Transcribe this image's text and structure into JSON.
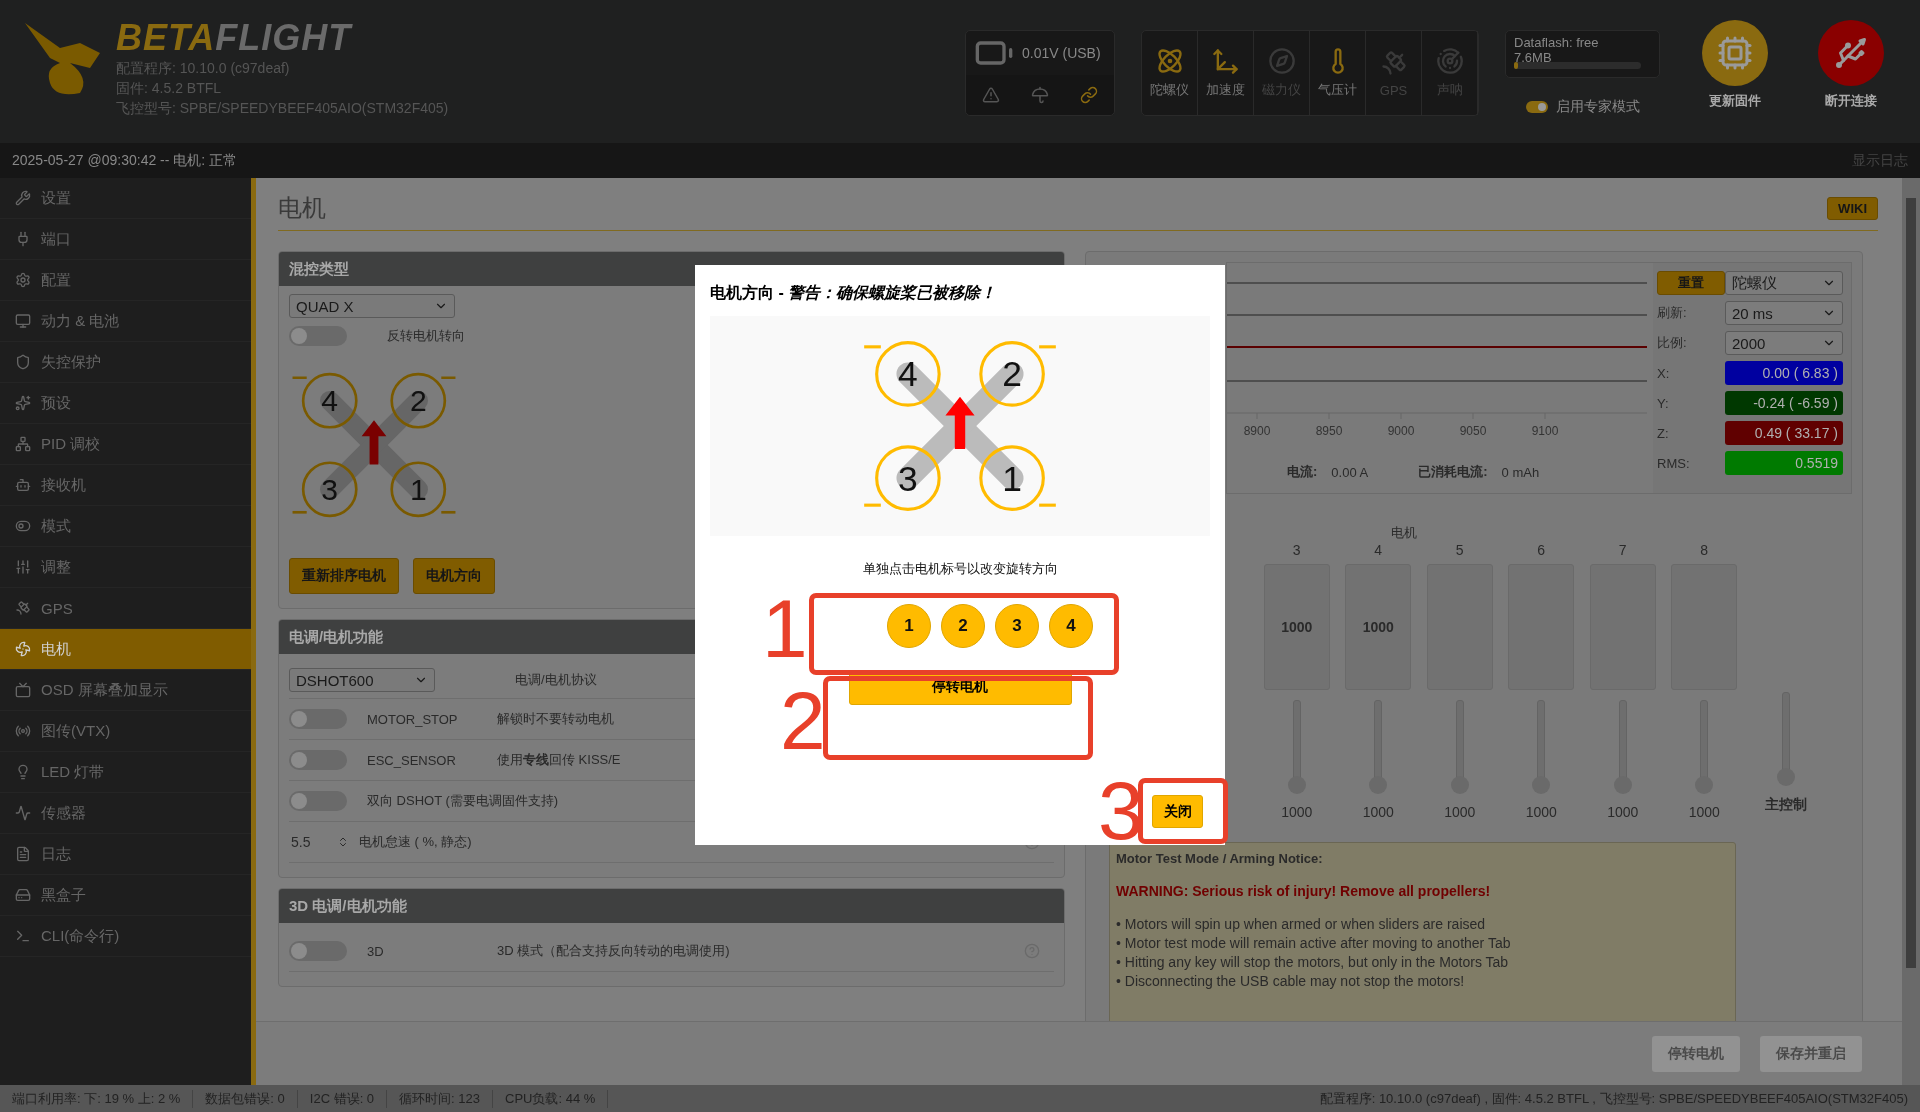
{
  "header": {
    "brand_a": "BETA",
    "brand_b": "FLIGHT",
    "info": [
      "配置程序: 10.10.0 (c97deaf)",
      "固件: 4.5.2 BTFL",
      "飞控型号: SPBE/SPEEDYBEEF405AIO(STM32F405)"
    ],
    "battery": {
      "reading": "0.01V (USB)"
    },
    "sensors": [
      {
        "kind": "gyro",
        "label": "陀螺仪",
        "active": true
      },
      {
        "kind": "accel",
        "label": "加速度",
        "active": true
      },
      {
        "kind": "mag",
        "label": "磁力仪",
        "active": false
      },
      {
        "kind": "baro",
        "label": "气压计",
        "active": true
      },
      {
        "kind": "gps",
        "label": "GPS",
        "active": false
      },
      {
        "kind": "sonar",
        "label": "声呐",
        "active": false
      }
    ],
    "dataflash": {
      "label": "Dataflash: free",
      "size": "7.6MB",
      "level": 0.03
    },
    "expert_mode": {
      "label": "启用专家模式",
      "on": true
    },
    "actions": [
      {
        "kind": "update",
        "label": "更新固件"
      },
      {
        "kind": "disconnect",
        "label": "断开连接"
      }
    ]
  },
  "log_bar": {
    "message": "2025-05-27 @09:30:42 -- 电机: 正常",
    "toggle": "显示日志"
  },
  "sidebar": {
    "items": [
      {
        "label": "设置",
        "selected": false
      },
      {
        "label": "端口",
        "selected": false
      },
      {
        "label": "配置",
        "selected": false
      },
      {
        "label": "动力 & 电池",
        "selected": false
      },
      {
        "label": "失控保护",
        "selected": false
      },
      {
        "label": "预设",
        "selected": false
      },
      {
        "label": "PID 调校",
        "selected": false
      },
      {
        "label": "接收机",
        "selected": false
      },
      {
        "label": "模式",
        "selected": false
      },
      {
        "label": "调整",
        "selected": false
      },
      {
        "label": "GPS",
        "selected": false
      },
      {
        "label": "电机",
        "selected": true
      },
      {
        "label": "OSD 屏幕叠加显示",
        "selected": false
      },
      {
        "label": "图传(VTX)",
        "selected": false
      },
      {
        "label": "LED 灯带",
        "selected": false
      },
      {
        "label": "传感器",
        "selected": false
      },
      {
        "label": "日志",
        "selected": false
      },
      {
        "label": "黑盒子",
        "selected": false
      },
      {
        "label": "CLI(命令行)",
        "selected": false
      }
    ]
  },
  "page": {
    "title": "电机",
    "wiki": "WIKI"
  },
  "mixer": {
    "title": "混控类型",
    "type": "QUAD X",
    "reverse": {
      "label": "反转电机转向",
      "on": false
    },
    "diagram": [
      "4",
      "2",
      "3",
      "1"
    ],
    "buttons": [
      "重新排序电机",
      "电机方向"
    ]
  },
  "esc": {
    "title": "电调/电机功能",
    "protocol": "DSHOT600",
    "protocol_label": "电调/电机协议",
    "features": [
      {
        "kind": "toggle",
        "name": "MOTOR_STOP",
        "description": "解锁时不要转动电机",
        "on": false
      },
      {
        "kind": "toggle",
        "name": "ESC_SENSOR",
        "description": "使用**专线**回传 KISS/E",
        "on": false
      },
      {
        "kind": "toggle",
        "description": "双向 DSHOT (需要电调固件支持)",
        "on": false
      },
      {
        "kind": "number",
        "value": "5.5",
        "description": "电机怠速 ( %, 静态)",
        "help": true
      }
    ]
  },
  "esc3d": {
    "title": "3D 电调/电机功能",
    "features": [
      {
        "kind": "toggle",
        "name": "3D",
        "description": "3D 模式（配合支持反向转动的电调使用)",
        "on": false,
        "help": true
      }
    ]
  },
  "sensor_graph": {
    "x_ticks": [
      "8900",
      "8950",
      "9000",
      "9050",
      "9100"
    ],
    "readouts": [
      {
        "label": "电流:",
        "value": "0.00 A"
      },
      {
        "label": "已消耗电流:",
        "value": "0 mAh"
      }
    ]
  },
  "graph_controls": {
    "reset": "重置",
    "sensor": "陀螺仪",
    "rows": [
      {
        "label": "刷新:",
        "value": "20 ms"
      },
      {
        "label": "比例:",
        "value": "2000"
      }
    ],
    "axes": [
      {
        "label": "X:",
        "value": "0.00 ( 6.83 )",
        "color": "#0000a0"
      },
      {
        "label": "Y:",
        "value": "-0.24 ( -6.59 )",
        "color": "#003800"
      },
      {
        "label": "Z:",
        "value": "0.49 ( 33.17 )",
        "color": "#600000"
      },
      {
        "label": "RMS:",
        "value": "0.5519",
        "color": "#007a00"
      }
    ]
  },
  "motors": {
    "title": "电机",
    "columns": [
      {
        "kind": "motor",
        "label": "3",
        "reading": "1000",
        "value": "1000",
        "level": 0
      },
      {
        "kind": "motor",
        "label": "4",
        "reading": "1000",
        "value": "1000",
        "level": 0
      },
      {
        "kind": "motor",
        "label": "5",
        "value": "1000",
        "level": 0
      },
      {
        "kind": "motor",
        "label": "6",
        "value": "1000",
        "level": 0
      },
      {
        "kind": "motor",
        "label": "7",
        "value": "1000",
        "level": 0
      },
      {
        "kind": "motor",
        "label": "8",
        "value": "1000",
        "level": 0
      },
      {
        "kind": "master",
        "value": "主控制",
        "level": 0
      }
    ]
  },
  "notice": {
    "title": "Motor Test Mode / Arming Notice:",
    "warning": "WARNING: Serious risk of injury! Remove all propellers!",
    "bullets": [
      "• Motors will spin up when armed or when sliders are raised",
      "• Motor test mode will remain active after moving to another Tab",
      "• Hitting any key will stop the motors, but only in the Motors Tab",
      "• Disconnecting the USB cable may not stop the motors!"
    ]
  },
  "footer": {
    "buttons": [
      "停转电机",
      "保存并重启"
    ]
  },
  "status_bar": {
    "items": [
      "端口利用率:  下: 19 % 上: 2 %",
      "数据包错误: 0",
      "I2C 错误: 0",
      "循环时间: 123",
      "CPU负载: 44 %"
    ],
    "right": "配置程序: 10.10.0 (c97deaf) , 固件: 4.5.2 BTFL , 飞控型号: SPBE/SPEEDYBEEF405AIO(STM32F405)"
  },
  "dialog": {
    "title": "电机方向 - *警告：确保螺旋桨已被移除！*",
    "diagram": [
      "4",
      "2",
      "3",
      "1"
    ],
    "hint": "单独点击电机标号以改变旋转方向",
    "motors": [
      "1",
      "2",
      "3",
      "4"
    ],
    "stop": "停转电机",
    "close": "关闭"
  },
  "annotations": [
    {
      "label": "1"
    },
    {
      "label": "2"
    },
    {
      "label": "3"
    }
  ]
}
